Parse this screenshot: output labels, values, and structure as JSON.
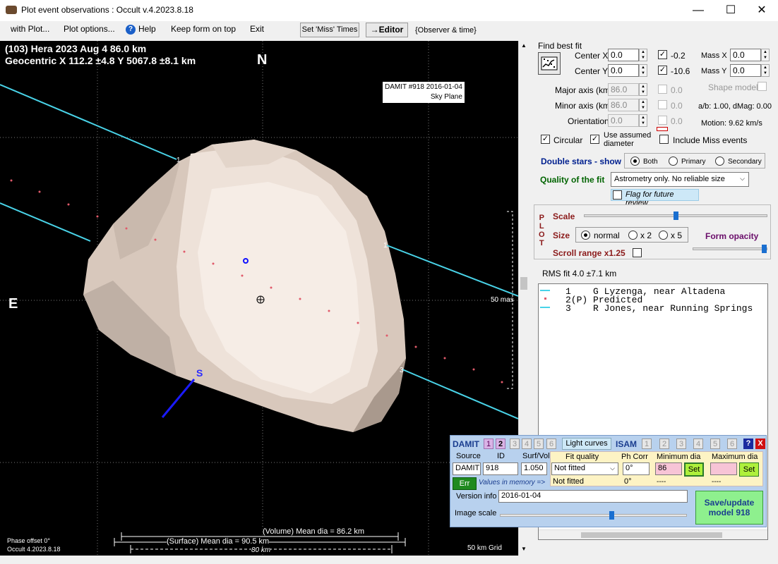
{
  "window": {
    "title": "Plot event observations : Occult v.4.2023.8.18"
  },
  "menu": {
    "with_plot": "with Plot...",
    "plot_options": "Plot options...",
    "help": "Help",
    "keep_on_top": "Keep form on top",
    "exit": "Exit",
    "set_miss_times": "Set 'Miss' Times",
    "editor": "→Editor",
    "observer_time": "{Observer & time}"
  },
  "plot": {
    "header_line1": "(103) Hera  2023 Aug 4   86.0 km",
    "header_line2": "Geocentric  X  112.2 ±4.8  Y 5067.8 ±8.1 km",
    "north": "N",
    "east": "E",
    "south": "S",
    "damit_label_line1": "DAMIT #918 2016-01-04",
    "damit_label_line2": "Sky Plane",
    "scale_50mas": "50 mas",
    "chord_labels": [
      "1",
      "1",
      "3"
    ],
    "volume_mean": "(Volume) Mean dia = 86.2 km",
    "surface_mean": "(Surface) Mean dia = 90.5 km",
    "scale_80km": "80 km",
    "phase_offset": "Phase offset 0°",
    "version": "Occult 4.2023.8.18",
    "grid": "50 km Grid"
  },
  "fit": {
    "find_best_fit": "Find best fit",
    "center_x_label": "Center X",
    "center_x": "0.0",
    "center_y_label": "Center Y",
    "center_y": "0.0",
    "offset_x": "-0.2",
    "offset_y": "-10.6",
    "mass_x_label": "Mass X",
    "mass_x": "0.0",
    "mass_y_label": "Mass Y",
    "mass_y": "0.0",
    "major_label": "Major axis (km)",
    "major": "86.0",
    "major_adj": "0.0",
    "minor_label": "Minor axis (km)",
    "minor": "86.0",
    "minor_adj": "0.0",
    "orient_label": "Orientation",
    "orient": "0.0",
    "orient_adj": "0.0",
    "shape_model": "Shape model",
    "ab_dmag": "a/b: 1.00, dMag: 0.00",
    "motion": "Motion: 9.62 km/s",
    "circular": "Circular",
    "use_assumed_line1": "Use assumed",
    "use_assumed_line2": "diameter",
    "include_miss": "Include Miss events"
  },
  "double_stars": {
    "label": "Double stars - show",
    "both": "Both",
    "primary": "Primary",
    "secondary": "Secondary"
  },
  "quality": {
    "label": "Quality of the fit",
    "value": "Astrometry only. No reliable size",
    "flag": "Flag for future review"
  },
  "plot_panel": {
    "vertical": [
      "P",
      "L",
      "O",
      "T"
    ],
    "scale": "Scale",
    "size": "Size",
    "normal": "normal",
    "x2": "x 2",
    "x5": "x 5",
    "form_opacity": "Form opacity",
    "scroll_range": "Scroll range x1.25",
    "scale_level": 0.5,
    "opacity_level": 1.0
  },
  "rms": "RMS fit 4.0 ±7.1 km",
  "observers": [
    {
      "num": "1",
      "name": "G Lyzenga, near Altadena"
    },
    {
      "num": "2(P)",
      "name": "Predicted"
    },
    {
      "num": "3",
      "name": "R Jones, near Running Springs"
    }
  ],
  "damit": {
    "title": "DAMIT",
    "models": [
      "1",
      "2",
      "3",
      "4",
      "5",
      "6"
    ],
    "light_curves": "Light curves",
    "isam": "ISAM",
    "isam_models": [
      "1",
      "2",
      "3",
      "4",
      "5",
      "6"
    ],
    "help": "?",
    "close": "X",
    "source_label": "Source",
    "source": "DAMIT",
    "id_label": "ID",
    "id": "918",
    "surfvol_label": "Surf/Vol",
    "surfvol": "1.050",
    "fit_quality_label": "Fit quality",
    "fit_quality": "Not fitted",
    "fit_quality_mem": "Not fitted",
    "phcorr_label": "Ph Corr",
    "phcorr": "0°",
    "phcorr_mem": "0°",
    "min_dia_label": "Minimum dia",
    "min_dia": "86",
    "min_dia_mem": "----",
    "max_dia_label": "Maximum dia",
    "max_dia": "",
    "max_dia_mem": "----",
    "set": "Set",
    "err": "Err",
    "values_in_memory": "Values in memory =>",
    "version_label": "Version info",
    "version": "2016-01-04",
    "image_scale_label": "Image scale",
    "image_scale_level": 0.6,
    "save_line1": "Save/update",
    "save_line2": "model 918"
  }
}
